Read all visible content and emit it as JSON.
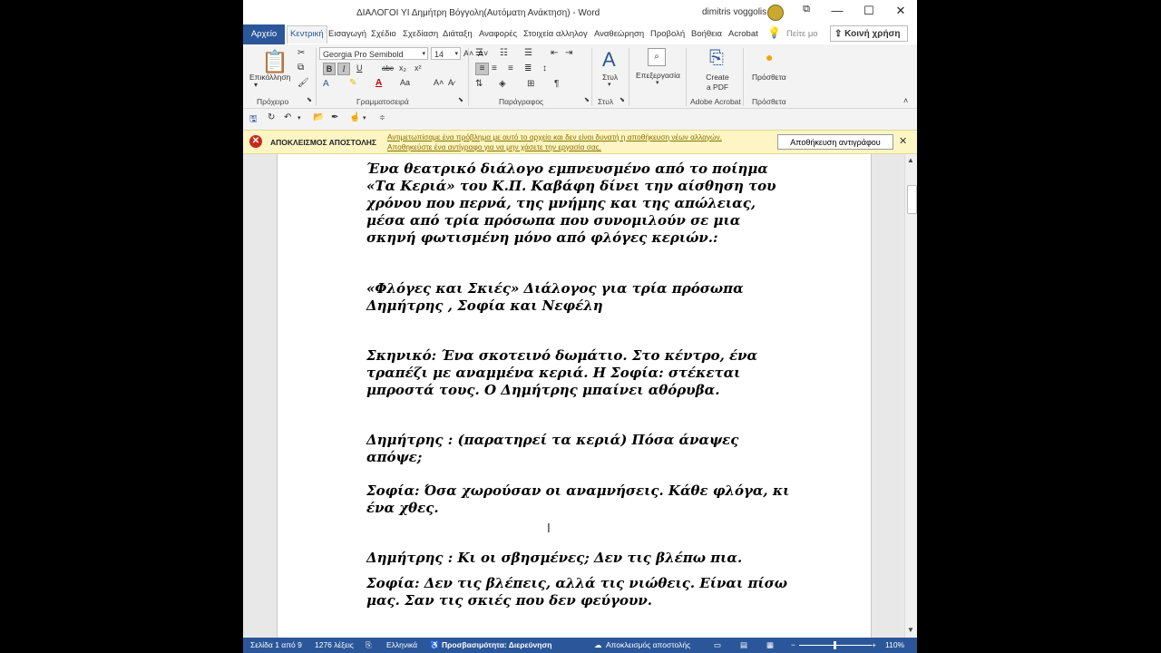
{
  "titlebar": {
    "title": "ΔΙΑΛΟΓΟΙ ΥΙ  Δημήτρη Βόγγολη(Αυτόματη Ανάκτηση)  -  Word",
    "user": "dimitris voggolis",
    "restore_icon": "restore-window-icon",
    "minimize": "—",
    "maximize": "☐",
    "close": "✕"
  },
  "tabs": {
    "file": "Αρχείο",
    "items": [
      "Κεντρική",
      "Εισαγωγή",
      "Σχέδιο",
      "Σχεδίαση",
      "Διάταξη",
      "Αναφορές",
      "Στοιχεία αλληλογ",
      "Αναθεώρηση",
      "Προβολή",
      "Βοήθεια",
      "Acrobat"
    ],
    "tell_me": "Πείτε μο",
    "share": "Κοινή χρήση"
  },
  "ribbon": {
    "clipboard": {
      "paste": "Επικόλληση",
      "label": "Πρόχειρο"
    },
    "font": {
      "name": "Georgia Pro Semibold",
      "size": "14",
      "bold": "B",
      "italic": "I",
      "underline": "U",
      "strike": "abc",
      "sub": "x₂",
      "sup": "x²",
      "label": "Γραμματοσειρά"
    },
    "paragraph": {
      "label": "Παράγραφος"
    },
    "styles": {
      "button": "Στυλ",
      "label": "Στυλ"
    },
    "editing": {
      "button": "Επεξεργασία"
    },
    "acrobat": {
      "button": "Create a PDF",
      "label": "Adobe Acrobat"
    },
    "addins": {
      "button": "Πρόσθετα",
      "label": "Πρόσθετα"
    }
  },
  "messagebar": {
    "heading": "ΑΠΟΚΛΕΙΣΜΟΣ ΑΠΟΣΤΟΛΗΣ",
    "line1": "Αντιμετωπίσαμε ένα πρόβλημα με αυτό το αρχείο και δεν είναι δυνατή η αποθήκευση νέων αλλαγών.",
    "line2": "Αποθηκεύστε ένα αντίγραφο για να μην χάσετε την εργασία σας.",
    "button": "Αποθήκευση αντιγράφου",
    "close": "✕"
  },
  "document": {
    "paragraphs": [
      "Ένα θεατρικό διάλογο εμπνευσμένο από το ποίημα «Τα Κεριά» του Κ.Π. Καβάφη δίνει την αίσθηση του   χρόνου που περνά, της μνήμης και της απώλειας, μέσα από τρία πρόσωπα που συνομιλούν σε μια σκηνή φωτισμένη μόνο από φλόγες κεριών.:",
      " «Φλόγες και Σκιές» Διάλογος για  τρία πρόσωπα  Δημήτρης , Σοφία και Νεφέλη",
      "Σκηνικό: Ένα σκοτεινό δωμάτιο. Στο κέντρο, ένα τραπέζι με αναμμένα κεριά. Η Σοφία: στέκεται μπροστά τους. Ο Δημήτρης  μπαίνει αθόρυβα.",
      "Δημήτρης  : (παρατηρεί τα κεριά) Πόσα άναψες απόψε;",
      "Σοφία: Όσα χωρούσαν οι αναμνήσεις. Κάθε φλόγα, κι ένα χθες.",
      "Δημήτρης  : Κι οι σβησμένες; Δεν τις βλέπω πια.",
      "Σοφία: Δεν τις βλέπεις, αλλά τις νιώθεις. Είναι πίσω μας. Σαν τις σκιές που δεν φεύγουν."
    ]
  },
  "status": {
    "page": "Σελίδα 1 από 9",
    "words": "1276 λέξεις",
    "language": "Ελληνικά",
    "accessibility": "Προσβασιμότητα: Διερεύνηση",
    "upload": "Αποκλεισμός αποστολής",
    "zoom": "110%"
  }
}
